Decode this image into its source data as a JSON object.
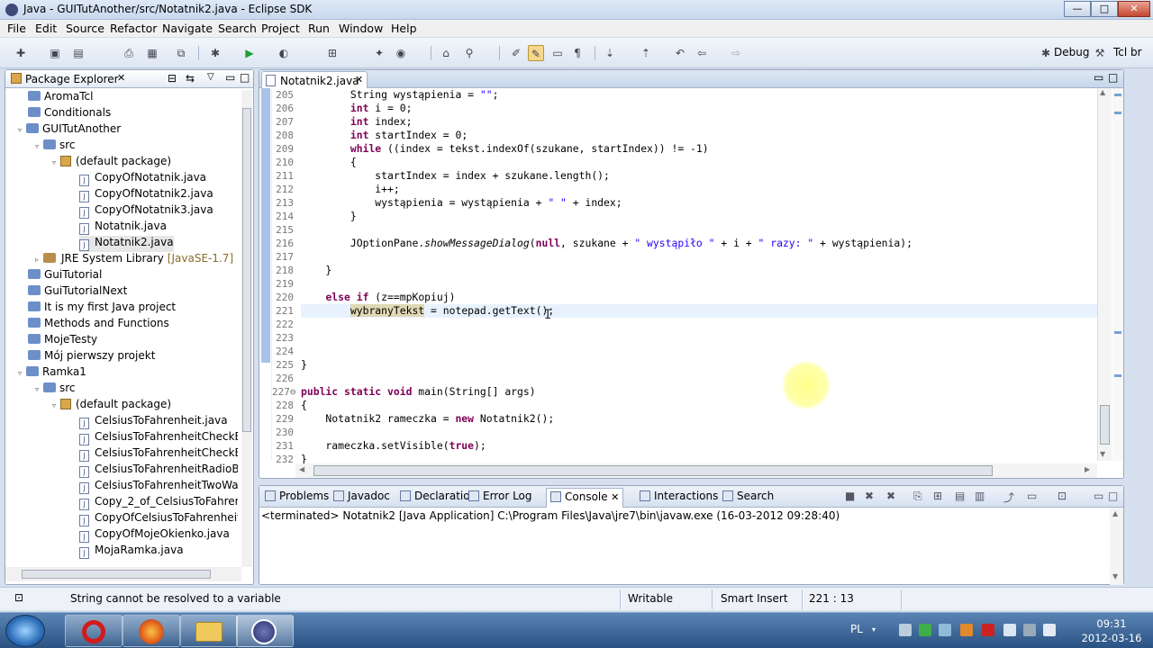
{
  "window": {
    "title": "Java - GUITutAnother/src/Notatnik2.java - Eclipse SDK",
    "min_label": "—",
    "max_label": "□",
    "close_label": "✕"
  },
  "menu": [
    "File",
    "Edit",
    "Source",
    "Refactor",
    "Navigate",
    "Search",
    "Project",
    "Run",
    "Window",
    "Help"
  ],
  "perspectives": {
    "debug": "Debug",
    "tcl": "Tcl br"
  },
  "package_explorer": {
    "title": "Package Explorer",
    "items": [
      {
        "label": "AromaTcl",
        "icon": "folder-icon"
      },
      {
        "label": "Conditionals",
        "icon": "folder-icon"
      },
      {
        "label": "GUITutAnother",
        "icon": "folder-icon"
      },
      {
        "label": "src",
        "icon": "folder-icon"
      },
      {
        "label": "(default package)",
        "icon": "package-icon"
      },
      {
        "label": "CopyOfNotatnik.java",
        "icon": "java-file-icon"
      },
      {
        "label": "CopyOfNotatnik2.java",
        "icon": "java-file-icon"
      },
      {
        "label": "CopyOfNotatnik3.java",
        "icon": "java-file-icon"
      },
      {
        "label": "Notatnik.java",
        "icon": "java-file-icon"
      },
      {
        "label": "Notatnik2.java",
        "icon": "java-file-icon"
      },
      {
        "label": "JRE System Library",
        "suffix": "[JavaSE-1.7]",
        "icon": "jar-icon"
      },
      {
        "label": "GuiTutorial",
        "icon": "folder-icon"
      },
      {
        "label": "GuiTutorialNext",
        "icon": "folder-icon"
      },
      {
        "label": "It is my first Java project",
        "icon": "folder-icon"
      },
      {
        "label": "Methods and Functions",
        "icon": "folder-icon"
      },
      {
        "label": "MojeTesty",
        "icon": "folder-icon"
      },
      {
        "label": "Mój pierwszy projekt",
        "icon": "folder-icon"
      },
      {
        "label": "Ramka1",
        "icon": "folder-icon"
      },
      {
        "label": "src",
        "icon": "folder-icon"
      },
      {
        "label": "(default package)",
        "icon": "package-icon"
      },
      {
        "label": "CelsiusToFahrenheit.java",
        "icon": "java-file-icon"
      },
      {
        "label": "CelsiusToFahrenheitCheckBox",
        "icon": "java-file-icon"
      },
      {
        "label": "CelsiusToFahrenheitCheckBox",
        "icon": "java-file-icon"
      },
      {
        "label": "CelsiusToFahrenheitRadioBut",
        "icon": "java-file-icon"
      },
      {
        "label": "CelsiusToFahrenheitTwoWayC",
        "icon": "java-file-icon"
      },
      {
        "label": "Copy_2_of_CelsiusToFahrenhe",
        "icon": "java-file-icon"
      },
      {
        "label": "CopyOfCelsiusToFahrenheit.ja",
        "icon": "java-file-icon"
      },
      {
        "label": "CopyOfMojeOkienko.java",
        "icon": "java-file-icon"
      },
      {
        "label": "MojaRamka.java",
        "icon": "java-file-icon"
      }
    ]
  },
  "editor": {
    "tab": "Notatnik2.java",
    "line_numbers": [
      "205",
      "206",
      "207",
      "208",
      "209",
      "210",
      "211",
      "212",
      "213",
      "214",
      "215",
      "216",
      "217",
      "218",
      "219",
      "220",
      "221",
      "222",
      "223",
      "224",
      "225",
      "226",
      "227⊖",
      "228",
      "229",
      "230",
      "231",
      "232"
    ],
    "lines": [
      [
        {
          "t": "        String wystąpienia = ",
          "c": ""
        },
        {
          "t": "\"\"",
          "c": "str"
        },
        {
          "t": ";",
          "c": ""
        }
      ],
      [
        {
          "t": "        ",
          "c": ""
        },
        {
          "t": "int",
          "c": "kw"
        },
        {
          "t": " i = 0;",
          "c": ""
        }
      ],
      [
        {
          "t": "        ",
          "c": ""
        },
        {
          "t": "int",
          "c": "kw"
        },
        {
          "t": " index;",
          "c": ""
        }
      ],
      [
        {
          "t": "        ",
          "c": ""
        },
        {
          "t": "int",
          "c": "kw"
        },
        {
          "t": " startIndex = 0;",
          "c": ""
        }
      ],
      [
        {
          "t": "        ",
          "c": ""
        },
        {
          "t": "while",
          "c": "kw"
        },
        {
          "t": " ((index = tekst.indexOf(szukane, startIndex)) != -1)",
          "c": ""
        }
      ],
      [
        {
          "t": "        {",
          "c": ""
        }
      ],
      [
        {
          "t": "            startIndex = index + szukane.length();",
          "c": ""
        }
      ],
      [
        {
          "t": "            i++;",
          "c": ""
        }
      ],
      [
        {
          "t": "            wystąpienia = wystąpienia + ",
          "c": ""
        },
        {
          "t": "\" \"",
          "c": "str"
        },
        {
          "t": " + index;",
          "c": ""
        }
      ],
      [
        {
          "t": "        }",
          "c": ""
        }
      ],
      [
        {
          "t": "",
          "c": ""
        }
      ],
      [
        {
          "t": "        JOptionPane.",
          "c": ""
        },
        {
          "t": "showMessageDialog",
          "c": "it"
        },
        {
          "t": "(",
          "c": ""
        },
        {
          "t": "null",
          "c": "kw"
        },
        {
          "t": ", szukane + ",
          "c": ""
        },
        {
          "t": "\" wystąpiło \"",
          "c": "str"
        },
        {
          "t": " + i + ",
          "c": ""
        },
        {
          "t": "\" razy: \"",
          "c": "str"
        },
        {
          "t": " + wystąpienia);",
          "c": ""
        }
      ],
      [
        {
          "t": "",
          "c": ""
        }
      ],
      [
        {
          "t": "    }",
          "c": ""
        }
      ],
      [
        {
          "t": "",
          "c": ""
        }
      ],
      [
        {
          "t": "    ",
          "c": ""
        },
        {
          "t": "else if",
          "c": "kw"
        },
        {
          "t": " (z==mpKopiuj)",
          "c": ""
        }
      ],
      [
        {
          "t": "        ",
          "c": ""
        },
        {
          "t": "wybranyTekst",
          "c": "occ"
        },
        {
          "t": " = notepad.getText();",
          "c": ""
        }
      ],
      [
        {
          "t": "",
          "c": ""
        }
      ],
      [
        {
          "t": "",
          "c": ""
        }
      ],
      [
        {
          "t": "",
          "c": ""
        }
      ],
      [
        {
          "t": "}",
          "c": ""
        }
      ],
      [
        {
          "t": "",
          "c": ""
        }
      ],
      [
        {
          "t": "public static void",
          "c": "kw"
        },
        {
          "t": " main(String[] args)",
          "c": ""
        }
      ],
      [
        {
          "t": "{",
          "c": ""
        }
      ],
      [
        {
          "t": "    Notatnik2 rameczka = ",
          "c": ""
        },
        {
          "t": "new",
          "c": "kw"
        },
        {
          "t": " Notatnik2();",
          "c": ""
        }
      ],
      [
        {
          "t": "",
          "c": ""
        }
      ],
      [
        {
          "t": "    rameczka.setVisible(",
          "c": ""
        },
        {
          "t": "true",
          "c": "kw"
        },
        {
          "t": ");",
          "c": ""
        }
      ],
      [
        {
          "t": "}",
          "c": ""
        }
      ]
    ]
  },
  "console": {
    "tabs": [
      "Problems",
      "Javadoc",
      "Declaration",
      "Error Log",
      "Console",
      "Interactions",
      "Search"
    ],
    "active_tab": "Console",
    "output": "<terminated> Notatnik2 [Java Application] C:\\Program Files\\Java\\jre7\\bin\\javaw.exe (16-03-2012 09:28:40)"
  },
  "status": {
    "message": "String cannot be resolved to a variable",
    "writable": "Writable",
    "insert_mode": "Smart Insert",
    "position": "221 : 13"
  },
  "taskbar": {
    "apps": [
      "opera-icon",
      "firefox-icon",
      "explorer-icon",
      "eclipse-icon"
    ],
    "lang": "PL",
    "time": "09:31",
    "date": "2012-03-16"
  }
}
